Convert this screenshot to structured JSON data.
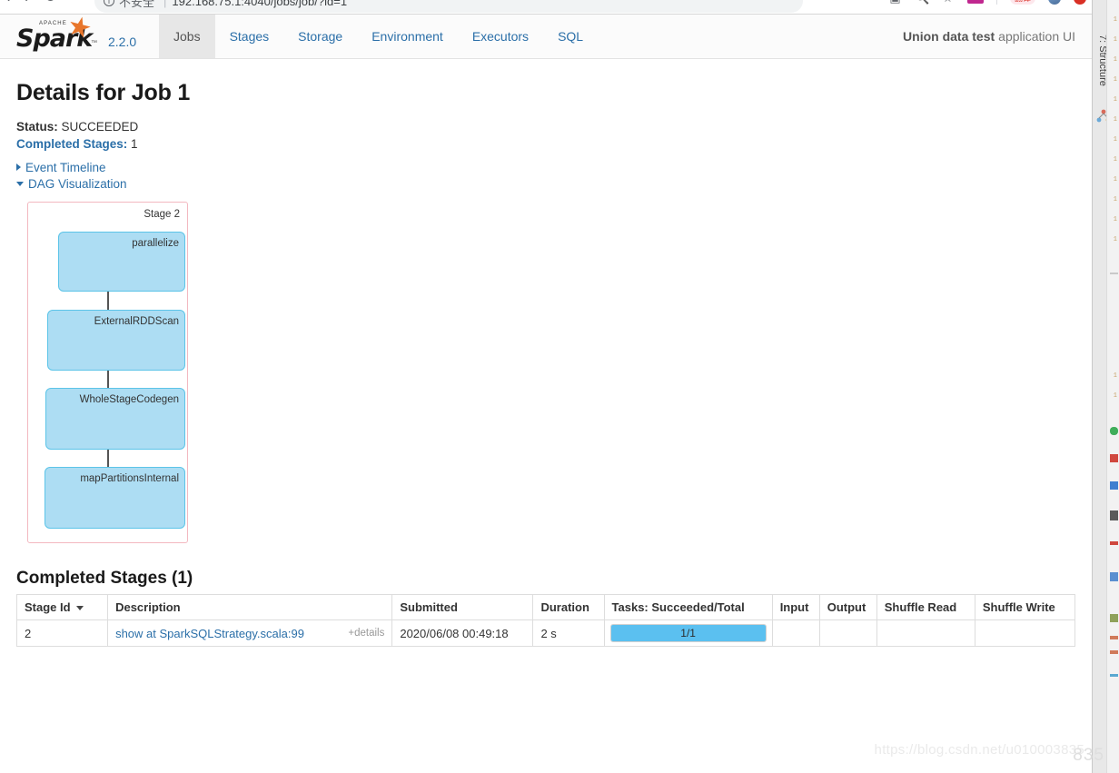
{
  "browser": {
    "back_icon": "back-arrow-icon",
    "forward_icon": "forward-arrow-icon",
    "reload_icon": "reload-icon",
    "info_icon": "info-circle-icon",
    "security_label": "不安全",
    "separator": "|",
    "url": "192.168.75.1:4040/jobs/job/?id=1",
    "icons": [
      {
        "name": "screencast-icon",
        "glyph": "❐"
      },
      {
        "name": "search-icon",
        "glyph": "⚲"
      },
      {
        "name": "bookmark-icon",
        "glyph": "☆"
      },
      {
        "name": "extension-rp-icon",
        "glyph": "RP"
      },
      {
        "name": "translate-pill-icon",
        "glyph": "翻译"
      },
      {
        "name": "profile-avatar-icon",
        "glyph": ""
      },
      {
        "name": "record-icon",
        "glyph": ""
      }
    ]
  },
  "navbar": {
    "logo_apache": "APACHE",
    "logo_word": "Spark",
    "logo_star": "★",
    "logo_tm": "™",
    "version": "2.2.0",
    "tabs": [
      {
        "label": "Jobs",
        "active": true
      },
      {
        "label": "Stages",
        "active": false
      },
      {
        "label": "Storage",
        "active": false
      },
      {
        "label": "Environment",
        "active": false
      },
      {
        "label": "Executors",
        "active": false
      },
      {
        "label": "SQL",
        "active": false
      }
    ],
    "app_name": "Union data test",
    "app_suffix": "application UI"
  },
  "job": {
    "title": "Details for Job 1",
    "status_key": "Status:",
    "status_value": "SUCCEEDED",
    "completed_stages_key": "Completed Stages:",
    "completed_stages_value": "1",
    "event_timeline_label": "Event Timeline",
    "dag_visualization_label": "DAG Visualization"
  },
  "dag": {
    "stage_label": "Stage 2",
    "border_color": "#f3b8c0",
    "node_fill": "#adddf3",
    "node_border": "#5cc4e8",
    "nodes": [
      {
        "label": "parallelize"
      },
      {
        "label": "ExternalRDDScan"
      },
      {
        "label": "WholeStageCodegen"
      },
      {
        "label": "mapPartitionsInternal"
      }
    ]
  },
  "stages_table": {
    "section_title": "Completed Stages (1)",
    "columns": [
      "Stage Id",
      "Description",
      "Submitted",
      "Duration",
      "Tasks: Succeeded/Total",
      "Input",
      "Output",
      "Shuffle Read",
      "Shuffle Write"
    ],
    "sorted_column": "Stage Id",
    "rows": [
      {
        "stage_id": "2",
        "description": "show at SparkSQLStrategy.scala:99",
        "details_label": "+details",
        "submitted": "2020/06/08 00:49:18",
        "duration": "2 s",
        "tasks_text": "1/1",
        "tasks_percent": 100,
        "input": "",
        "output": "",
        "shuffle_read": "",
        "shuffle_write": ""
      }
    ],
    "progress_color": "#5bc0f0"
  },
  "watermark": "https://blog.csdn.net/u010003835",
  "ide": {
    "tool_window_label": "7: Structure",
    "structure_icon": "structure-tree-icon",
    "marker_number": "835"
  }
}
